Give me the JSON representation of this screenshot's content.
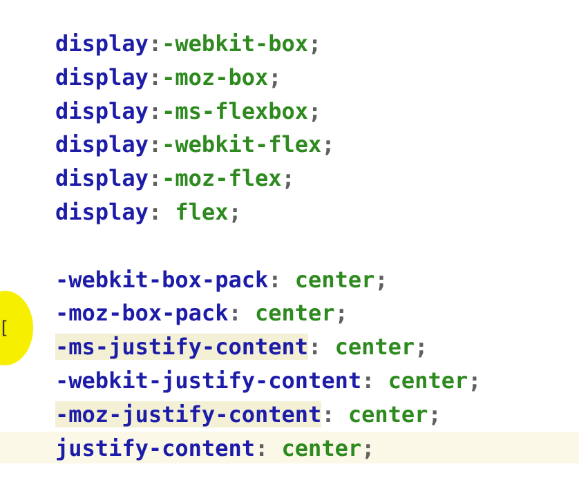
{
  "code": {
    "lines": [
      {
        "prop": "display",
        "sep": ":",
        "val": "-webkit-box",
        "end": ";"
      },
      {
        "prop": "display",
        "sep": ":",
        "val": "-moz-box",
        "end": ";"
      },
      {
        "prop": "display",
        "sep": ":",
        "val": "-ms-flexbox",
        "end": ";"
      },
      {
        "prop": "display",
        "sep": ":",
        "val": "-webkit-flex",
        "end": ";"
      },
      {
        "prop": "display",
        "sep": ":",
        "val": "-moz-flex",
        "end": ";"
      },
      {
        "prop": "display",
        "sep": ": ",
        "val": "flex",
        "end": ";"
      },
      {
        "prop": "-webkit-box-pack",
        "sep": ": ",
        "val": "center",
        "end": ";"
      },
      {
        "prop": "-moz-box-pack",
        "sep": ": ",
        "val": "center",
        "end": ";"
      },
      {
        "prop": "-ms-justify-content",
        "sep": ": ",
        "val": "center",
        "end": ";"
      },
      {
        "prop": "-webkit-justify-content",
        "sep": ": ",
        "val": "center",
        "end": ";"
      },
      {
        "prop": "-moz-justify-content",
        "sep": ": ",
        "val": "center",
        "end": ";"
      },
      {
        "prop": "justify-content",
        "sep": ": ",
        "val": "center",
        "end": ";"
      }
    ]
  },
  "cursor": {
    "glyph": "["
  },
  "colors": {
    "property": "#1c1ca8",
    "value": "#2e8a1f",
    "punctuation": "#5f5f5f",
    "highlight": "#f3f0d6",
    "cursor_spotlight": "#f6ef00"
  }
}
